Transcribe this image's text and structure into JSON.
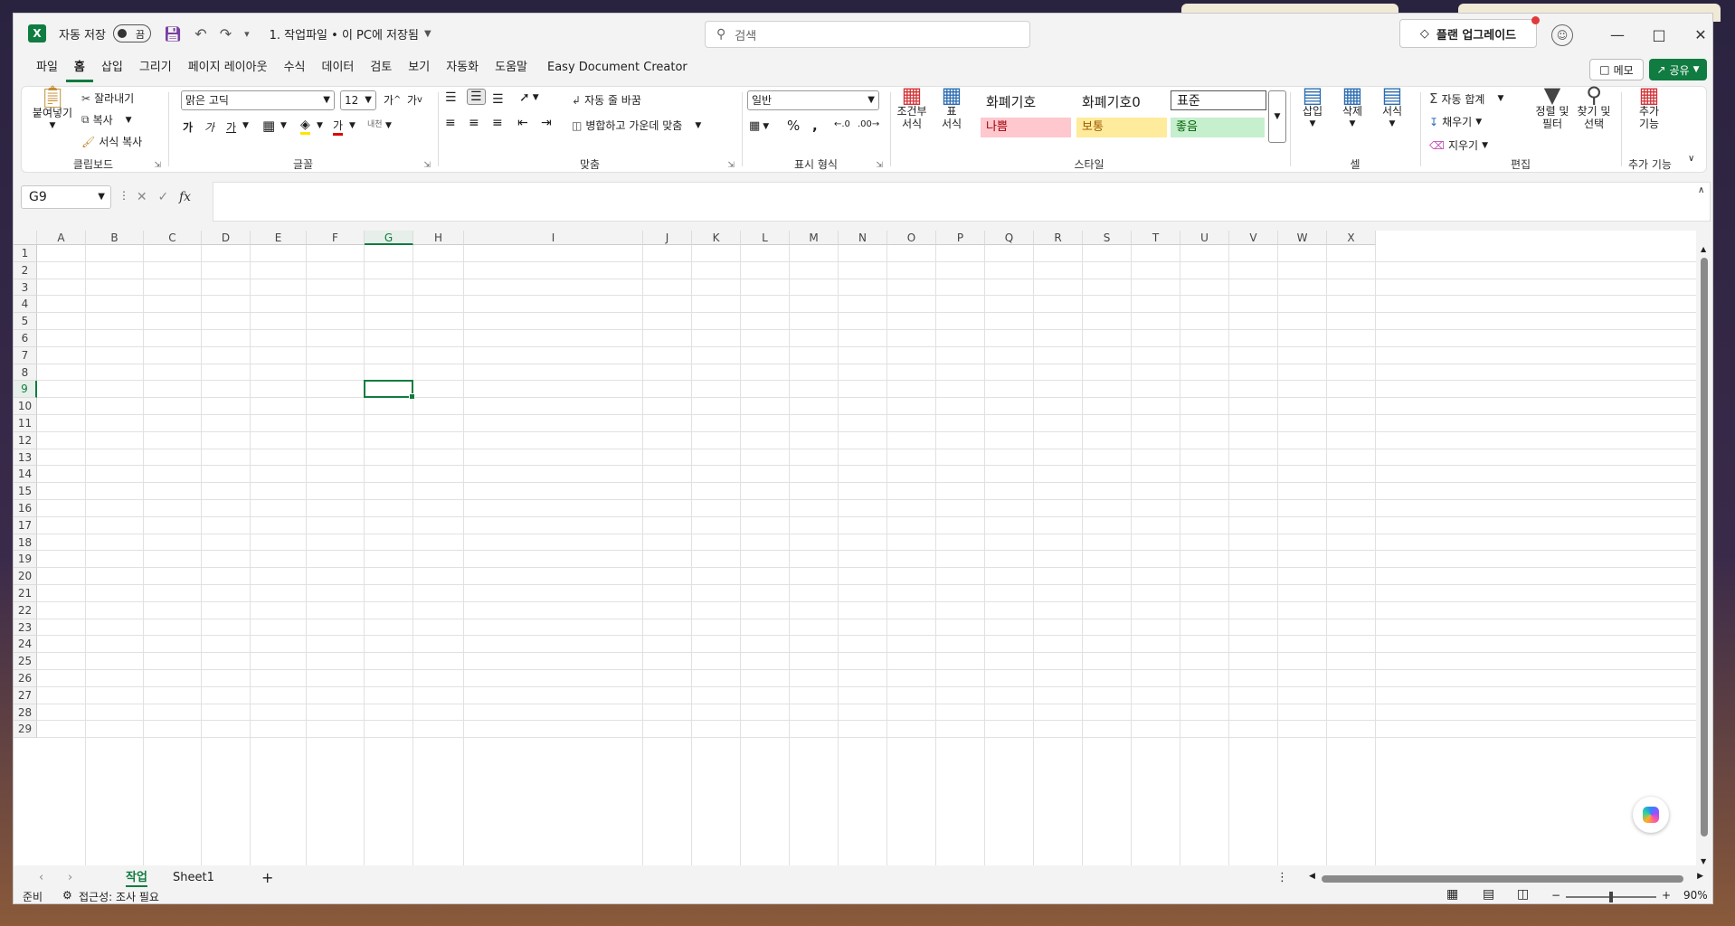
{
  "titlebar": {
    "logo": "X",
    "autosave_label": "자동 저장",
    "toggle_state": "끔",
    "filename": "1. 작업파일 • 이 PC에 저장됨",
    "search_placeholder": "검색",
    "upgrade_label": "플랜 업그레이드"
  },
  "menu": {
    "tabs": [
      "파일",
      "홈",
      "삽입",
      "그리기",
      "페이지 레이아웃",
      "수식",
      "데이터",
      "검토",
      "보기",
      "자동화",
      "도움말",
      "Easy Document Creator"
    ],
    "active_tab": "홈",
    "memo_label": "메모",
    "share_label": "공유"
  },
  "ribbon": {
    "clipboard": {
      "label": "클립보드",
      "paste": "붙여넣기",
      "cut": "잘라내기",
      "copy": "복사",
      "format_painter": "서식 복사"
    },
    "font": {
      "label": "글꼴",
      "font_name": "맑은 고딕",
      "font_size": "12"
    },
    "alignment": {
      "label": "맞춤",
      "wrap_text": "자동 줄 바꿈",
      "merge_center": "병합하고 가운데 맞춤"
    },
    "number": {
      "label": "표시 형식",
      "format": "일반"
    },
    "styles": {
      "label": "스타일",
      "conditional_formatting": [
        "조건부",
        "서식"
      ],
      "format_as_table": [
        "표",
        "서식"
      ],
      "cells": [
        "화폐기호",
        "화폐기호0",
        "표준",
        "나쁨",
        "보통",
        "좋음"
      ]
    },
    "cells_group": {
      "label": "셀",
      "insert": "삽입",
      "delete": "삭제",
      "format": "서식"
    },
    "editing": {
      "label": "편집",
      "autosum": "자동 합계",
      "fill": "채우기",
      "clear": "지우기",
      "sort_filter": [
        "정렬 및",
        "필터"
      ],
      "find_select": [
        "찾기 및",
        "선택"
      ]
    },
    "addins": {
      "label": "추가 기능",
      "button": [
        "추가",
        "기능"
      ]
    }
  },
  "formula_bar": {
    "name_box": "G9",
    "fx": "fx",
    "formula": ""
  },
  "grid": {
    "columns": [
      "A",
      "B",
      "C",
      "D",
      "E",
      "F",
      "G",
      "H",
      "I",
      "J",
      "K",
      "L",
      "M",
      "N",
      "O",
      "P",
      "Q",
      "R",
      "S",
      "T",
      "U",
      "V",
      "W",
      "X"
    ],
    "rows": [
      "1",
      "2",
      "3",
      "4",
      "5",
      "6",
      "7",
      "8",
      "9",
      "10",
      "11",
      "12",
      "13",
      "14",
      "15",
      "16",
      "17",
      "18",
      "19",
      "20",
      "21",
      "22",
      "23",
      "24",
      "25",
      "26",
      "27",
      "28",
      "29"
    ],
    "selected_cell": "G9"
  },
  "sheets": {
    "tabs": [
      "작업",
      "Sheet1"
    ],
    "active": "작업"
  },
  "status": {
    "ready": "준비",
    "accessibility": "접근성: 조사 필요",
    "zoom": "90%"
  },
  "colors": {
    "accent": "#107c41",
    "bad_fill": "#ffc7ce",
    "bad_text": "#9c0006",
    "neutral_fill": "#ffeb9c",
    "neutral_text": "#9c5700",
    "good_fill": "#c6efce",
    "good_text": "#006100"
  }
}
